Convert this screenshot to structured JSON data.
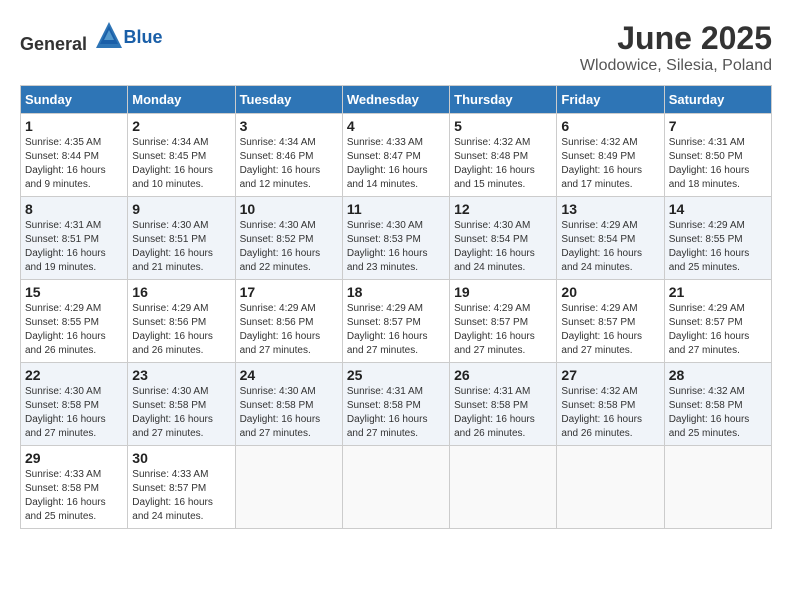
{
  "logo": {
    "general": "General",
    "blue": "Blue"
  },
  "title": {
    "month": "June 2025",
    "location": "Wlodowice, Silesia, Poland"
  },
  "headers": [
    "Sunday",
    "Monday",
    "Tuesday",
    "Wednesday",
    "Thursday",
    "Friday",
    "Saturday"
  ],
  "weeks": [
    [
      {
        "day": "1",
        "info": "Sunrise: 4:35 AM\nSunset: 8:44 PM\nDaylight: 16 hours\nand 9 minutes."
      },
      {
        "day": "2",
        "info": "Sunrise: 4:34 AM\nSunset: 8:45 PM\nDaylight: 16 hours\nand 10 minutes."
      },
      {
        "day": "3",
        "info": "Sunrise: 4:34 AM\nSunset: 8:46 PM\nDaylight: 16 hours\nand 12 minutes."
      },
      {
        "day": "4",
        "info": "Sunrise: 4:33 AM\nSunset: 8:47 PM\nDaylight: 16 hours\nand 14 minutes."
      },
      {
        "day": "5",
        "info": "Sunrise: 4:32 AM\nSunset: 8:48 PM\nDaylight: 16 hours\nand 15 minutes."
      },
      {
        "day": "6",
        "info": "Sunrise: 4:32 AM\nSunset: 8:49 PM\nDaylight: 16 hours\nand 17 minutes."
      },
      {
        "day": "7",
        "info": "Sunrise: 4:31 AM\nSunset: 8:50 PM\nDaylight: 16 hours\nand 18 minutes."
      }
    ],
    [
      {
        "day": "8",
        "info": "Sunrise: 4:31 AM\nSunset: 8:51 PM\nDaylight: 16 hours\nand 19 minutes."
      },
      {
        "day": "9",
        "info": "Sunrise: 4:30 AM\nSunset: 8:51 PM\nDaylight: 16 hours\nand 21 minutes."
      },
      {
        "day": "10",
        "info": "Sunrise: 4:30 AM\nSunset: 8:52 PM\nDaylight: 16 hours\nand 22 minutes."
      },
      {
        "day": "11",
        "info": "Sunrise: 4:30 AM\nSunset: 8:53 PM\nDaylight: 16 hours\nand 23 minutes."
      },
      {
        "day": "12",
        "info": "Sunrise: 4:30 AM\nSunset: 8:54 PM\nDaylight: 16 hours\nand 24 minutes."
      },
      {
        "day": "13",
        "info": "Sunrise: 4:29 AM\nSunset: 8:54 PM\nDaylight: 16 hours\nand 24 minutes."
      },
      {
        "day": "14",
        "info": "Sunrise: 4:29 AM\nSunset: 8:55 PM\nDaylight: 16 hours\nand 25 minutes."
      }
    ],
    [
      {
        "day": "15",
        "info": "Sunrise: 4:29 AM\nSunset: 8:55 PM\nDaylight: 16 hours\nand 26 minutes."
      },
      {
        "day": "16",
        "info": "Sunrise: 4:29 AM\nSunset: 8:56 PM\nDaylight: 16 hours\nand 26 minutes."
      },
      {
        "day": "17",
        "info": "Sunrise: 4:29 AM\nSunset: 8:56 PM\nDaylight: 16 hours\nand 27 minutes."
      },
      {
        "day": "18",
        "info": "Sunrise: 4:29 AM\nSunset: 8:57 PM\nDaylight: 16 hours\nand 27 minutes."
      },
      {
        "day": "19",
        "info": "Sunrise: 4:29 AM\nSunset: 8:57 PM\nDaylight: 16 hours\nand 27 minutes."
      },
      {
        "day": "20",
        "info": "Sunrise: 4:29 AM\nSunset: 8:57 PM\nDaylight: 16 hours\nand 27 minutes."
      },
      {
        "day": "21",
        "info": "Sunrise: 4:29 AM\nSunset: 8:57 PM\nDaylight: 16 hours\nand 27 minutes."
      }
    ],
    [
      {
        "day": "22",
        "info": "Sunrise: 4:30 AM\nSunset: 8:58 PM\nDaylight: 16 hours\nand 27 minutes."
      },
      {
        "day": "23",
        "info": "Sunrise: 4:30 AM\nSunset: 8:58 PM\nDaylight: 16 hours\nand 27 minutes."
      },
      {
        "day": "24",
        "info": "Sunrise: 4:30 AM\nSunset: 8:58 PM\nDaylight: 16 hours\nand 27 minutes."
      },
      {
        "day": "25",
        "info": "Sunrise: 4:31 AM\nSunset: 8:58 PM\nDaylight: 16 hours\nand 27 minutes."
      },
      {
        "day": "26",
        "info": "Sunrise: 4:31 AM\nSunset: 8:58 PM\nDaylight: 16 hours\nand 26 minutes."
      },
      {
        "day": "27",
        "info": "Sunrise: 4:32 AM\nSunset: 8:58 PM\nDaylight: 16 hours\nand 26 minutes."
      },
      {
        "day": "28",
        "info": "Sunrise: 4:32 AM\nSunset: 8:58 PM\nDaylight: 16 hours\nand 25 minutes."
      }
    ],
    [
      {
        "day": "29",
        "info": "Sunrise: 4:33 AM\nSunset: 8:58 PM\nDaylight: 16 hours\nand 25 minutes."
      },
      {
        "day": "30",
        "info": "Sunrise: 4:33 AM\nSunset: 8:57 PM\nDaylight: 16 hours\nand 24 minutes."
      },
      {
        "day": "",
        "info": ""
      },
      {
        "day": "",
        "info": ""
      },
      {
        "day": "",
        "info": ""
      },
      {
        "day": "",
        "info": ""
      },
      {
        "day": "",
        "info": ""
      }
    ]
  ]
}
